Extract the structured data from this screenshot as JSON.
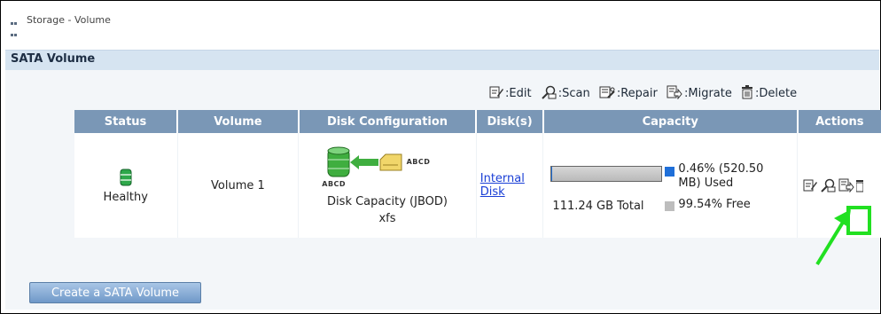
{
  "breadcrumb": {
    "text": "Storage - Volume"
  },
  "section": {
    "title": "SATA Volume"
  },
  "legend": {
    "edit": ":Edit",
    "scan": ":Scan",
    "repair": ":Repair",
    "migrate": ":Migrate",
    "delete": ":Delete"
  },
  "table": {
    "headers": {
      "status": "Status",
      "volume": "Volume",
      "disk_config": "Disk Configuration",
      "disks": "Disk(s)",
      "capacity": "Capacity",
      "actions": "Actions"
    },
    "row": {
      "status": "Healthy",
      "volume": "Volume 1",
      "disk_label_top": "ABCD",
      "disk_label_bottom": "ABCD",
      "disk_capacity": "Disk Capacity (JBOD)",
      "filesystem": "xfs",
      "disks_link": "Internal Disk",
      "capacity_used": "0.46% (520.50 MB) Used",
      "capacity_used_fraction": 0.0046,
      "capacity_total": "111.24 GB Total",
      "capacity_free": "99.54% Free"
    }
  },
  "create_button": "Create a SATA Volume",
  "colors": {
    "header_bg": "#7a97b6",
    "section_bg": "#d6e4f1",
    "used": "#1f6fd8",
    "highlight": "#21e021"
  }
}
